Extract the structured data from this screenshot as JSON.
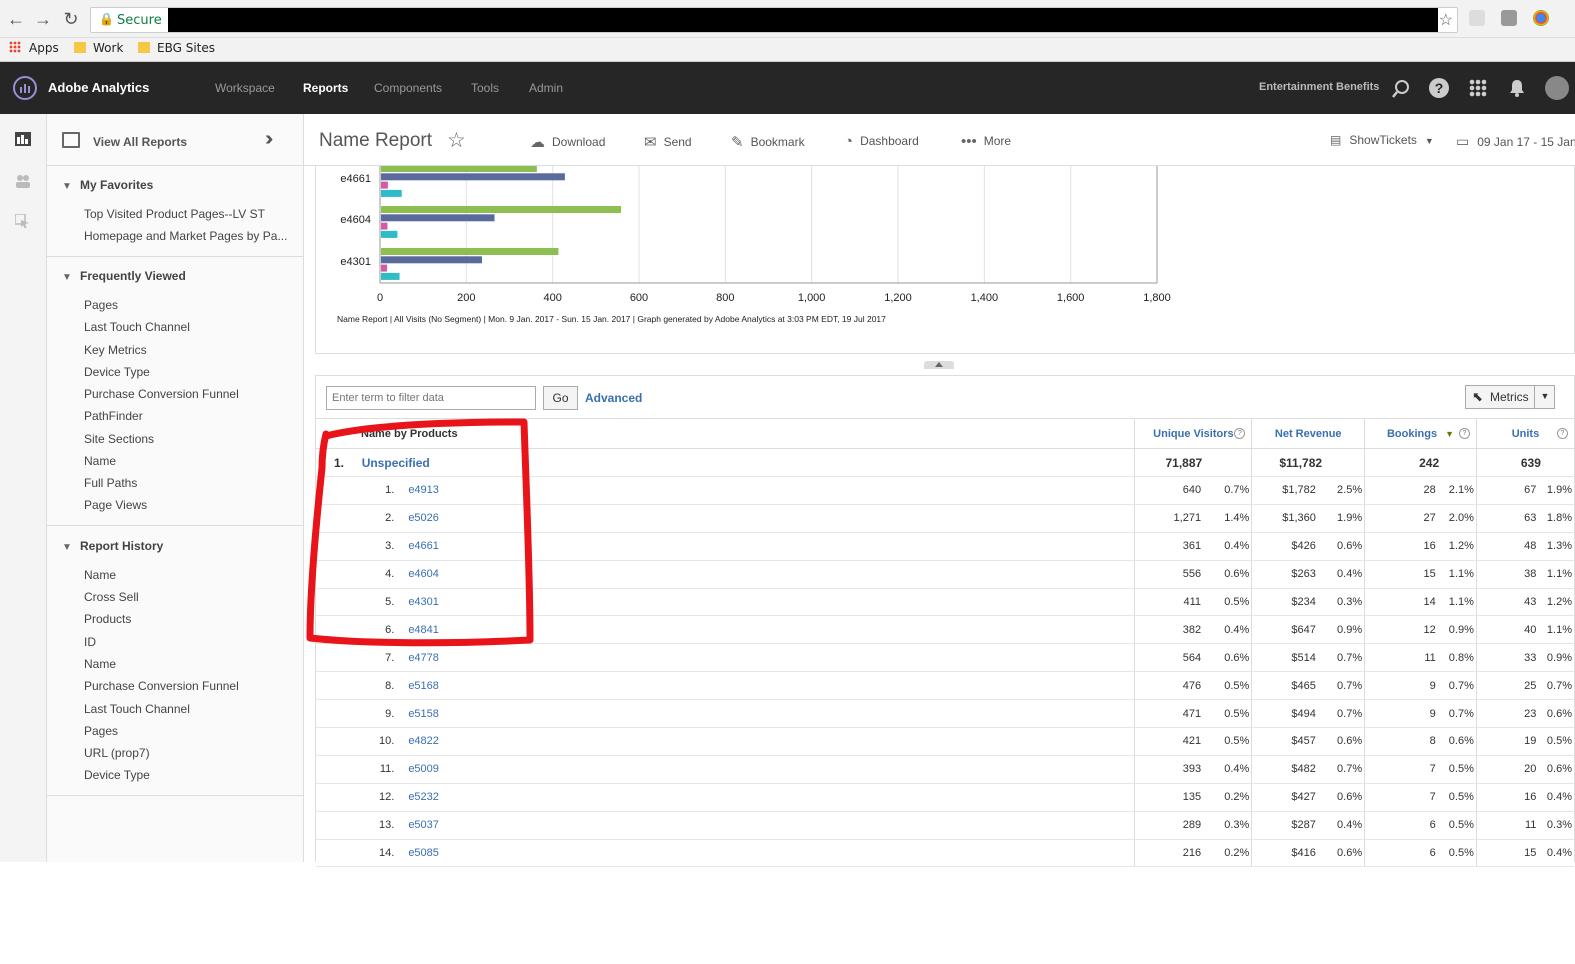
{
  "browser": {
    "back": "←",
    "forward": "→",
    "reload": "↻",
    "secure_label": "Secure",
    "bookmarks": [
      "Apps",
      "Work",
      "EBG Sites"
    ]
  },
  "topnav": {
    "brand": "Adobe Analytics",
    "items": [
      "Workspace",
      "Reports",
      "Components",
      "Tools",
      "Admin"
    ],
    "active": "Reports",
    "company": "Entertainment Benefits"
  },
  "sidebar": {
    "title": "View All Reports",
    "favorites": {
      "title": "My Favorites",
      "items": [
        "Top Visited Product Pages--LV ST",
        "Homepage and Market Pages by Pa..."
      ]
    },
    "frequent": {
      "title": "Frequently Viewed",
      "items": [
        "Pages",
        "Last Touch Channel",
        "Key Metrics",
        "Device Type",
        "Purchase Conversion Funnel",
        "PathFinder",
        "Site Sections",
        "Name",
        "Full Paths",
        "Page Views"
      ]
    },
    "history": {
      "title": "Report History",
      "items": [
        "Name",
        "Cross Sell",
        "Products",
        "ID",
        "Name",
        "Purchase Conversion Funnel",
        "Last Touch Channel",
        "Pages",
        "URL (prop7)",
        "Device Type"
      ]
    }
  },
  "toolbar": {
    "title": "Name Report",
    "download": "Download",
    "send": "Send",
    "bookmark": "Bookmark",
    "dashboard": "Dashboard",
    "more": "More",
    "report_suite": "ShowTickets",
    "date_range": "09 Jan 17 - 15 Jan"
  },
  "chart_data": {
    "type": "bar",
    "orientation": "horizontal",
    "categories": [
      "e4661",
      "e4604",
      "e4301"
    ],
    "series": [
      {
        "values": [
          361,
          556,
          411
        ],
        "color": "#8cbf4f"
      },
      {
        "values": [
          426,
          263,
          234
        ],
        "color": "#5b6a9c"
      },
      {
        "values": [
          16,
          15,
          14
        ],
        "color": "#d45aa8"
      },
      {
        "values": [
          48,
          38,
          43
        ],
        "color": "#2fbcc9"
      }
    ],
    "xlim": [
      0,
      1800
    ],
    "ticks": [
      "0",
      "200",
      "400",
      "600",
      "800",
      "1,000",
      "1,200",
      "1,400",
      "1,600",
      "1,800"
    ],
    "footer": "Name Report | All Visits (No Segment) | Mon.  9 Jan. 2017 - Sun. 15 Jan. 2017 | Graph generated by Adobe Analytics at  3:03 PM EDT, 19 Jul 2017"
  },
  "table": {
    "filter_placeholder": "Enter term to filter data",
    "go": "Go",
    "advanced": "Advanced",
    "metrics": "Metrics",
    "dimension_header": "Name by Products",
    "metric_headers": [
      "Unique Visitors",
      "Net Revenue",
      "Bookings",
      "Units"
    ],
    "total": {
      "rank": "1.",
      "name": "Unspecified",
      "values": [
        "71,887",
        "$11,782",
        "242",
        "639"
      ]
    },
    "rows": [
      {
        "rank": "1.",
        "name": "e4913",
        "uv": "640",
        "uvp": "0.7%",
        "nr": "$1,782",
        "nrp": "2.5%",
        "bk": "28",
        "bkp": "2.1%",
        "un": "67",
        "unp": "1.9%"
      },
      {
        "rank": "2.",
        "name": "e5026",
        "uv": "1,271",
        "uvp": "1.4%",
        "nr": "$1,360",
        "nrp": "1.9%",
        "bk": "27",
        "bkp": "2.0%",
        "un": "63",
        "unp": "1.8%"
      },
      {
        "rank": "3.",
        "name": "e4661",
        "uv": "361",
        "uvp": "0.4%",
        "nr": "$426",
        "nrp": "0.6%",
        "bk": "16",
        "bkp": "1.2%",
        "un": "48",
        "unp": "1.3%"
      },
      {
        "rank": "4.",
        "name": "e4604",
        "uv": "556",
        "uvp": "0.6%",
        "nr": "$263",
        "nrp": "0.4%",
        "bk": "15",
        "bkp": "1.1%",
        "un": "38",
        "unp": "1.1%"
      },
      {
        "rank": "5.",
        "name": "e4301",
        "uv": "411",
        "uvp": "0.5%",
        "nr": "$234",
        "nrp": "0.3%",
        "bk": "14",
        "bkp": "1.1%",
        "un": "43",
        "unp": "1.2%"
      },
      {
        "rank": "6.",
        "name": "e4841",
        "uv": "382",
        "uvp": "0.4%",
        "nr": "$647",
        "nrp": "0.9%",
        "bk": "12",
        "bkp": "0.9%",
        "un": "40",
        "unp": "1.1%"
      },
      {
        "rank": "7.",
        "name": "e4778",
        "uv": "564",
        "uvp": "0.6%",
        "nr": "$514",
        "nrp": "0.7%",
        "bk": "11",
        "bkp": "0.8%",
        "un": "33",
        "unp": "0.9%"
      },
      {
        "rank": "8.",
        "name": "e5168",
        "uv": "476",
        "uvp": "0.5%",
        "nr": "$465",
        "nrp": "0.7%",
        "bk": "9",
        "bkp": "0.7%",
        "un": "25",
        "unp": "0.7%"
      },
      {
        "rank": "9.",
        "name": "e5158",
        "uv": "471",
        "uvp": "0.5%",
        "nr": "$494",
        "nrp": "0.7%",
        "bk": "9",
        "bkp": "0.7%",
        "un": "23",
        "unp": "0.6%"
      },
      {
        "rank": "10.",
        "name": "e4822",
        "uv": "421",
        "uvp": "0.5%",
        "nr": "$457",
        "nrp": "0.6%",
        "bk": "8",
        "bkp": "0.6%",
        "un": "19",
        "unp": "0.5%"
      },
      {
        "rank": "11.",
        "name": "e5009",
        "uv": "393",
        "uvp": "0.4%",
        "nr": "$482",
        "nrp": "0.7%",
        "bk": "7",
        "bkp": "0.5%",
        "un": "20",
        "unp": "0.6%"
      },
      {
        "rank": "12.",
        "name": "e5232",
        "uv": "135",
        "uvp": "0.2%",
        "nr": "$427",
        "nrp": "0.6%",
        "bk": "7",
        "bkp": "0.5%",
        "un": "16",
        "unp": "0.4%"
      },
      {
        "rank": "13.",
        "name": "e5037",
        "uv": "289",
        "uvp": "0.3%",
        "nr": "$287",
        "nrp": "0.4%",
        "bk": "6",
        "bkp": "0.5%",
        "un": "11",
        "unp": "0.3%"
      },
      {
        "rank": "14.",
        "name": "e5085",
        "uv": "216",
        "uvp": "0.2%",
        "nr": "$416",
        "nrp": "0.6%",
        "bk": "6",
        "bkp": "0.5%",
        "un": "15",
        "unp": "0.4%"
      }
    ]
  }
}
